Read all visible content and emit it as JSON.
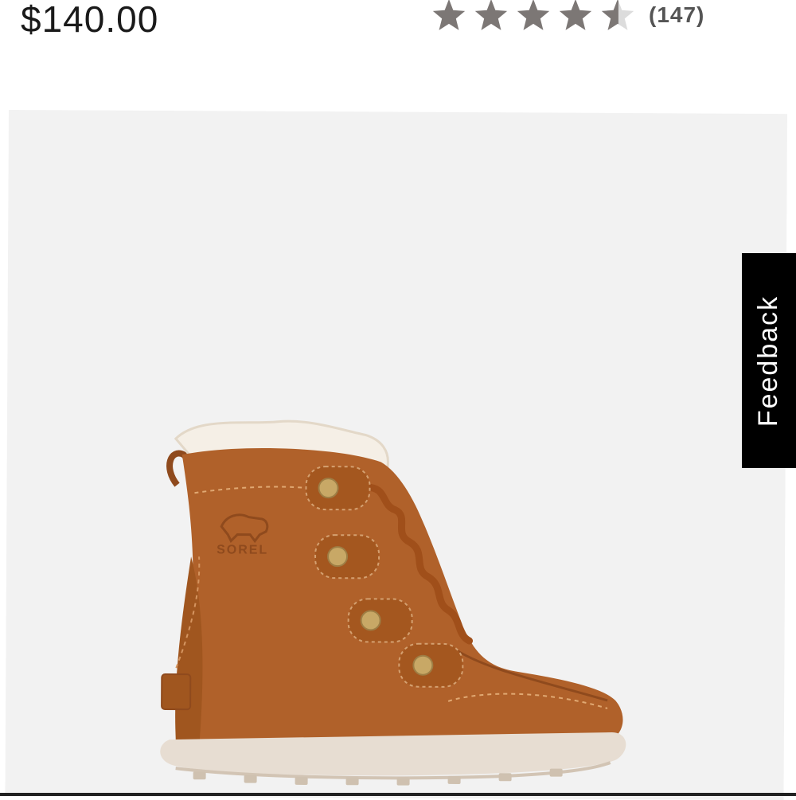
{
  "product": {
    "price": "$140.00",
    "rating": {
      "value": 4.5,
      "max": 5,
      "review_count": "(147)",
      "star_color": "#7c7775"
    },
    "image": {
      "subject": "boot-image",
      "brand_emboss": "SOREL",
      "background": "#f2f2f2",
      "colors": {
        "suede": "#b0612a",
        "sole": "#e7ddd2",
        "fur": "#f5efe6",
        "eyelet": "#c8a866"
      }
    }
  },
  "feedback": {
    "label": "Feedback"
  }
}
